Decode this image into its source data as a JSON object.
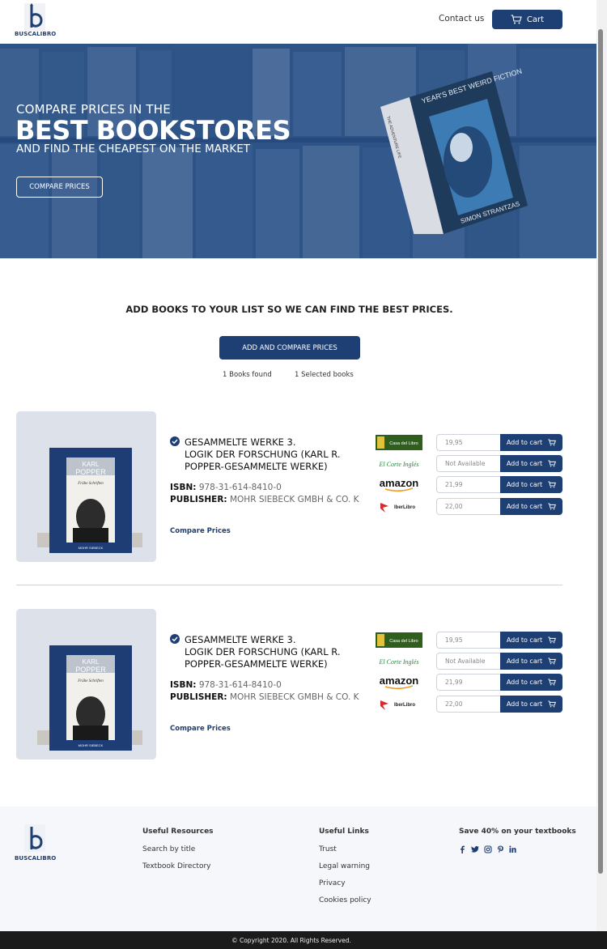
{
  "header": {
    "logo_text": "BUSCALIBRO",
    "contact_label": "Contact us",
    "cart_label": "Cart"
  },
  "hero": {
    "line1": "COMPARE PRICES IN THE",
    "line2": "BEST BOOKSTORES",
    "line3": "AND FIND THE CHEAPEST ON THE MARKET",
    "button_label": "COMPARE PRICES",
    "book_cover_title": "YEAR'S BEST WEIRD FICTION",
    "book_cover_editor": "SIMON STRANTZAS",
    "book_spine": "THE ADVENTURE LIFE"
  },
  "search": {
    "tagline": "ADD BOOKS TO YOUR LIST SO WE CAN FIND THE BEST PRICES.",
    "add_button_label": "ADD AND COMPARE PRICES",
    "books_found": "1 Books found",
    "selected_books": "1 Selected books"
  },
  "results": [
    {
      "title_line1": "GESAMMELTE WERKE 3.",
      "title_line2": "LOGIK DER FORSCHUNG (KARL R.",
      "title_line3": "POPPER-GESAMMELTE WERKE)",
      "isbn_label": "ISBN:",
      "isbn": "978-31-614-8410-0",
      "publisher_label": "PUBLISHER:",
      "publisher": "MOHR SIEBECK GMBH & CO. K",
      "compare_label": "Compare Prices",
      "cover_author_first": "KARL",
      "cover_author_last": "POPPER",
      "cover_subtitle": "Frühe Schriften",
      "cover_publisher": "MOHR SIEBECK",
      "stores": [
        {
          "name": "Casa del Libro",
          "price": "19,95",
          "cart_label": "Add to cart"
        },
        {
          "name": "El Corte Inglés",
          "price": "Not Available",
          "cart_label": "Add to cart"
        },
        {
          "name": "amazon",
          "price": "21,99",
          "cart_label": "Add to cart"
        },
        {
          "name": "IberLibro",
          "price": "22,00",
          "cart_label": "Add to cart"
        }
      ]
    },
    {
      "title_line1": "GESAMMELTE WERKE 3.",
      "title_line2": "LOGIK DER FORSCHUNG (KARL R.",
      "title_line3": "POPPER-GESAMMELTE WERKE)",
      "isbn_label": "ISBN:",
      "isbn": "978-31-614-8410-0",
      "publisher_label": "PUBLISHER:",
      "publisher": "MOHR SIEBECK GMBH & CO. K",
      "compare_label": "Compare Prices",
      "cover_author_first": "KARL",
      "cover_author_last": "POPPER",
      "cover_subtitle": "Frühe Schriften",
      "cover_publisher": "MOHR SIEBECK",
      "stores": [
        {
          "name": "Casa del Libro",
          "price": "19,95",
          "cart_label": "Add to cart"
        },
        {
          "name": "El Corte Inglés",
          "price": "Not Available",
          "cart_label": "Add to cart"
        },
        {
          "name": "amazon",
          "price": "21,99",
          "cart_label": "Add to cart"
        },
        {
          "name": "IberLibro",
          "price": "22,00",
          "cart_label": "Add to cart"
        }
      ]
    }
  ],
  "footer": {
    "logo_text": "BUSCALIBRO",
    "resources": {
      "heading": "Useful Resources",
      "items": [
        "Search by title",
        "Textbook Directory"
      ]
    },
    "links": {
      "heading": "Useful Links",
      "items": [
        "Trust",
        "Legal warning",
        "Privacy",
        "Cookies policy"
      ]
    },
    "promo": {
      "heading": "Save 40% on your textbooks",
      "social": [
        "facebook-icon",
        "twitter-icon",
        "instagram-icon",
        "pinterest-icon",
        "linkedin-icon"
      ]
    },
    "copyright": "© Copyright 2020. All Rights Reserved."
  },
  "colors": {
    "brand": "#1e3f73",
    "hero_overlay": "#2b5288",
    "footer_bg": "#f5f7fa",
    "copyright_bg": "#1b1b1b"
  }
}
